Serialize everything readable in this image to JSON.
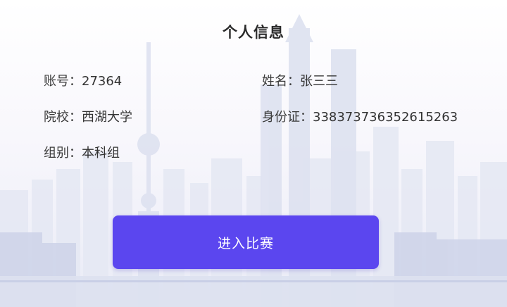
{
  "title": "个人信息",
  "fields": {
    "account": {
      "label": "账号：",
      "value": "27364"
    },
    "name": {
      "label": "姓名：",
      "value": "张三三"
    },
    "school": {
      "label": "院校：",
      "value": "西湖大学"
    },
    "id_card": {
      "label": "身份证：",
      "value": "338373736352615263"
    },
    "group": {
      "label": "组别：",
      "value": "本科组"
    }
  },
  "enter_button": {
    "label": "进入比赛",
    "color": "#5b46ef"
  },
  "colors": {
    "background": "#f7f6fb",
    "skyline": "#d9def0",
    "text": "#333333"
  }
}
